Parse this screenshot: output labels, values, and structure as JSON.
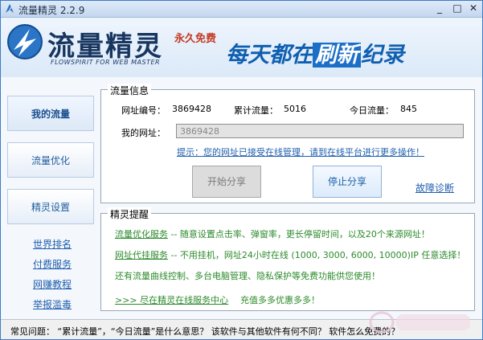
{
  "window": {
    "title": "流量精灵 2.2.9"
  },
  "header": {
    "logo_text": "流量精灵",
    "logo_subtitle": "FLOWSPIRIT FOR WEB MASTER",
    "free_badge": "永久免费",
    "slogan_a": "每天都在",
    "slogan_b": "刷新",
    "slogan_c": "纪录"
  },
  "nav": {
    "items": [
      {
        "label": "我的流量"
      },
      {
        "label": "流量优化"
      },
      {
        "label": "精灵设置"
      }
    ],
    "links": [
      {
        "label": "世界排名"
      },
      {
        "label": "付费服务"
      },
      {
        "label": "网赚教程"
      },
      {
        "label": "举报滥毒"
      }
    ]
  },
  "flow_info": {
    "legend": "流量信息",
    "site_id_label": "网址编号：",
    "site_id": "3869428",
    "total_label": "累计流量：",
    "total": "5016",
    "today_label": "今日流量：",
    "today": "845",
    "my_url_label": "我的网址：",
    "my_url_value": "3869428",
    "tip": "提示：您的网址已接受在线管理，请到在线平台进行更多操作！",
    "start_button": "开始分享",
    "stop_button": "停止分享",
    "diagnose_link": "故障诊断"
  },
  "reminder": {
    "legend": "精灵提醒",
    "line1_link": "流量优化服务",
    "line1_text": " -- 随意设置点击率、弹窗率，更长停留时间，以及20个来源网址！",
    "line2_link": "网址代挂服务",
    "line2_text": " -- 不用挂机，网址24小时在线 (1000, 3000, 6000, 10000)IP 任意选择！",
    "line3": "还有流量曲线控制、多台电脑管理、隐私保护等免费功能供您使用！",
    "service_center_link": ">>> 尽在精灵在线服务中心",
    "recharge": "充值多多优惠多多！"
  },
  "status": {
    "text": "常见问题：  “累计流量”，“今日流量”是什么意思？ 该软件与其他软件有何不同？ 软件怎么免费的？"
  },
  "colors": {
    "accent": "#1f5fae",
    "green_text": "#2c8a2c",
    "free_red": "#c43b23"
  }
}
